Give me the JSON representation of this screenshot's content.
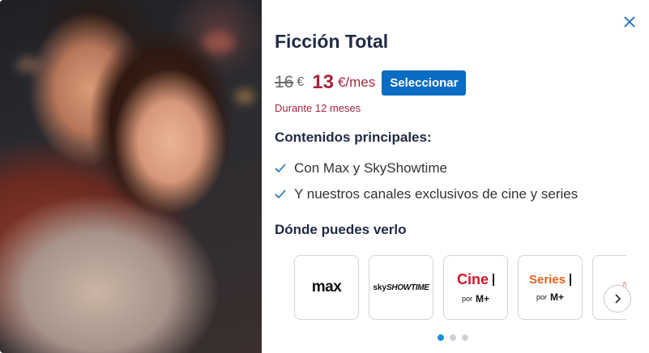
{
  "plan": {
    "title": "Ficción Total",
    "old_price": "16",
    "old_currency": "€",
    "new_price": "13",
    "new_unit": "€/mes",
    "select_label": "Seleccionar",
    "duration": "Durante 12 meses"
  },
  "contents": {
    "heading": "Contenidos principales:",
    "items": [
      {
        "label": "Con Max y SkyShowtime"
      },
      {
        "label": "Y nuestros canales exclusivos de cine y series"
      }
    ]
  },
  "where": {
    "heading": "Dónde puedes verlo",
    "channels": [
      {
        "name": "max"
      },
      {
        "sky": "sky",
        "name": "SHOWTIME"
      },
      {
        "name": "Cine",
        "por": "por",
        "brand": "M+"
      },
      {
        "name": "Series",
        "por": "por",
        "brand": "M+"
      }
    ]
  },
  "icons": {
    "close": "close-icon",
    "check": "check-icon",
    "next": "chevron-right-icon"
  },
  "colors": {
    "accent": "#0a6cc2",
    "price": "#a3263b",
    "title": "#1f2a44",
    "dot_active": "#1593e0"
  },
  "pagination": {
    "current": 1,
    "total": 3
  }
}
